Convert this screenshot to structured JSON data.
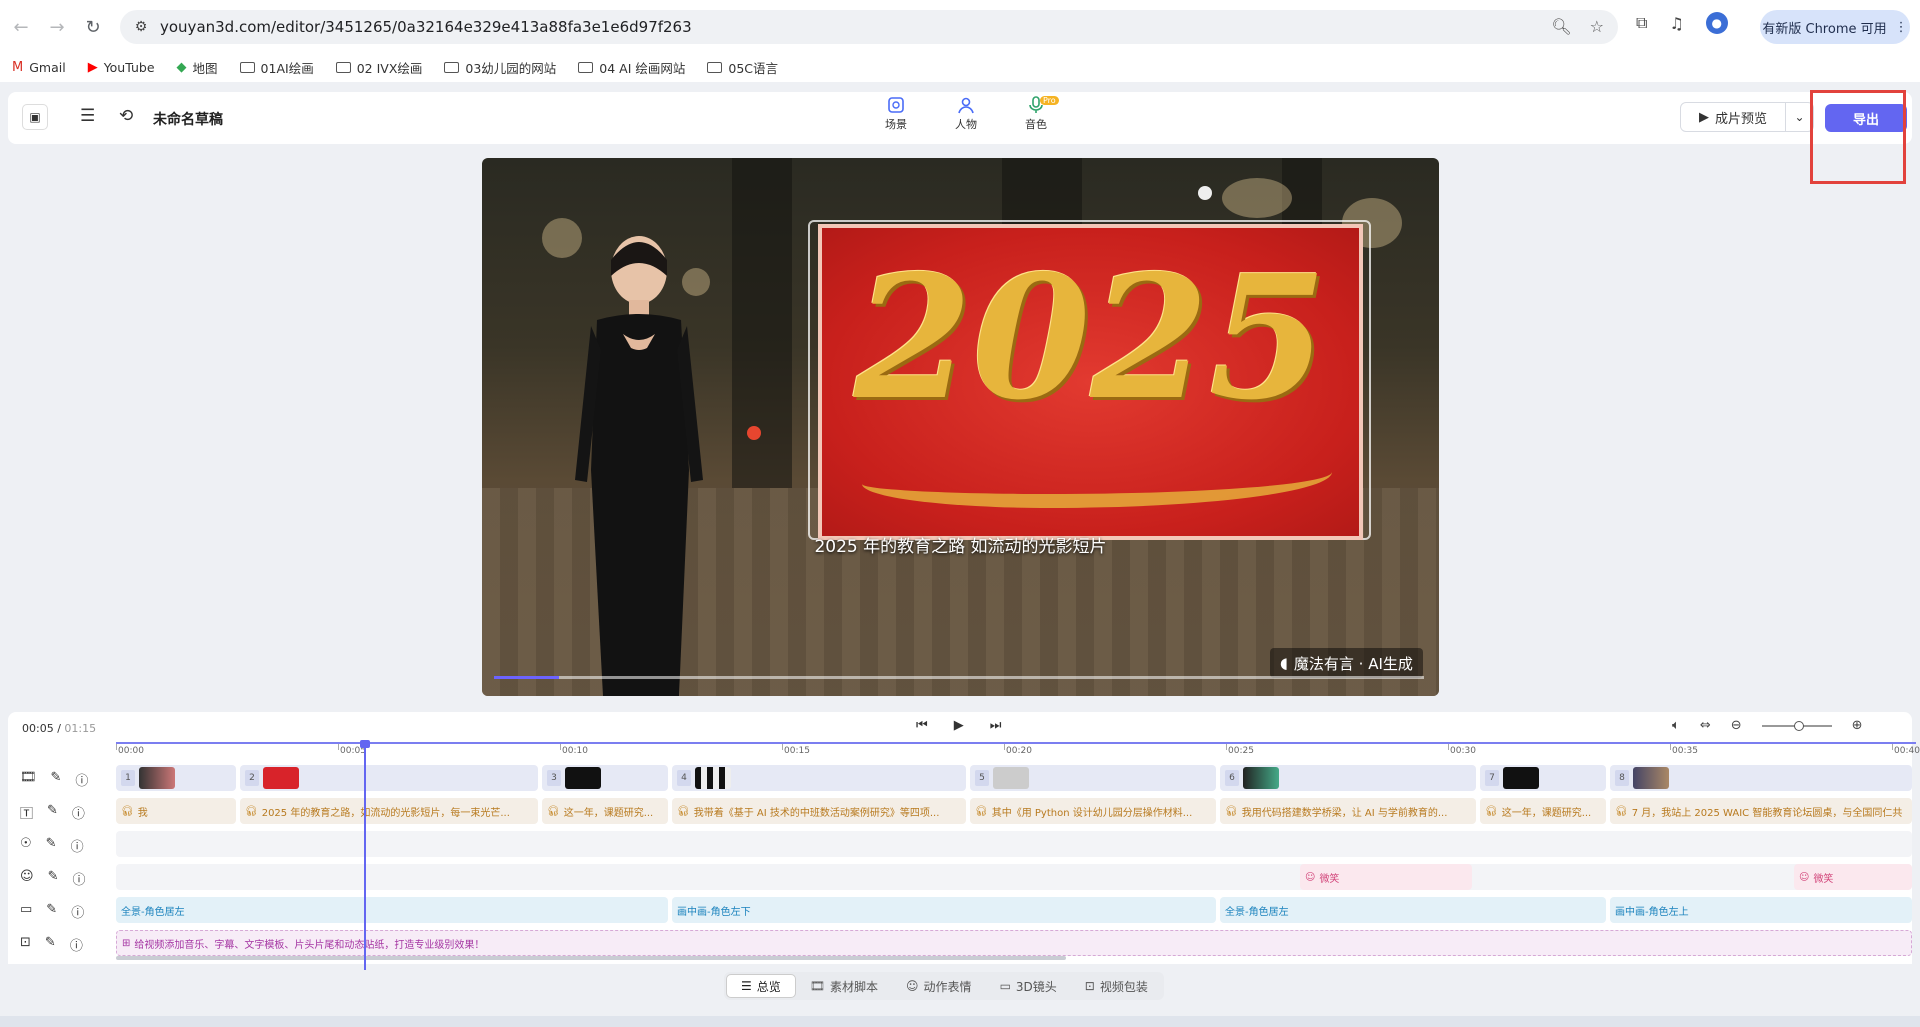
{
  "browser": {
    "url": "youyan3d.com/editor/3451265/0a32164e329e413a88fa3e1e6d97f263",
    "update_label": "有新版 Chrome 可用",
    "bookmarks": [
      {
        "label": "Gmail",
        "icon": "gmail-icon"
      },
      {
        "label": "YouTube",
        "icon": "youtube-icon"
      },
      {
        "label": "地图",
        "icon": "maps-icon"
      },
      {
        "label": "01AI绘画",
        "icon": "folder-icon"
      },
      {
        "label": "02 IVX绘画",
        "icon": "folder-icon"
      },
      {
        "label": "03幼儿园的网站",
        "icon": "folder-icon"
      },
      {
        "label": "04 AI 绘画网站",
        "icon": "folder-icon"
      },
      {
        "label": "05C语言",
        "icon": "folder-icon"
      }
    ]
  },
  "header": {
    "draft_title": "未命名草稿",
    "tabs": [
      {
        "label": "场景",
        "icon": "scene-icon"
      },
      {
        "label": "人物",
        "icon": "person-icon"
      },
      {
        "label": "音色",
        "icon": "mic-icon",
        "badge": "Pro"
      }
    ],
    "preview_label": "成片预览",
    "export_label": "导出",
    "accent_color": "#6366f1",
    "highlight_color": "#e2423c"
  },
  "video": {
    "big_text": "2025",
    "caption": "2025 年的教育之路 如流动的光影短片",
    "watermark": "魔法有言 · AI生成",
    "progress": 0.07
  },
  "timeline": {
    "current": "00:05",
    "total": "01:15",
    "ticks": [
      "00:00",
      "00:05",
      "00:10",
      "00:15",
      "00:20",
      "00:25",
      "00:30",
      "00:35",
      "00:40"
    ],
    "scenes": [
      {
        "num": "1"
      },
      {
        "num": "2"
      },
      {
        "num": "3"
      },
      {
        "num": "4"
      },
      {
        "num": "5"
      },
      {
        "num": "6"
      },
      {
        "num": "7"
      },
      {
        "num": "8"
      }
    ],
    "scripts": [
      "我",
      "2025 年的教育之路，如流动的光影短片，每一束光芒...",
      "这一年，课题研究...",
      "我带着《基于 AI 技术的中班数活动案例研究》等四项...",
      "其中《用 Python 设计幼儿园分层操作材料...",
      "我用代码搭建数学桥梁，让 AI 与学前教育的...",
      "这一年，课题研究...",
      "7 月，我站上 2025 WAIC 智能教育论坛圆桌，与全国同仁共"
    ],
    "emotions": [
      "微笑",
      "微笑"
    ],
    "cameras": [
      "全景-角色居左",
      "画中画-角色左下",
      "全景-角色居左",
      "画中画-角色左上"
    ],
    "package_hint": "给视频添加音乐、字幕、文字模板、片头片尾和动态贴纸，打造专业级别效果！"
  },
  "bottom_tabs": [
    {
      "label": "总览",
      "icon": "list-icon",
      "active": true
    },
    {
      "label": "素材脚本",
      "icon": "film-icon",
      "active": false
    },
    {
      "label": "动作表情",
      "icon": "smile-icon",
      "active": false
    },
    {
      "label": "3D镜头",
      "icon": "camera-icon",
      "active": false
    },
    {
      "label": "视频包装",
      "icon": "package-icon",
      "active": false
    }
  ]
}
